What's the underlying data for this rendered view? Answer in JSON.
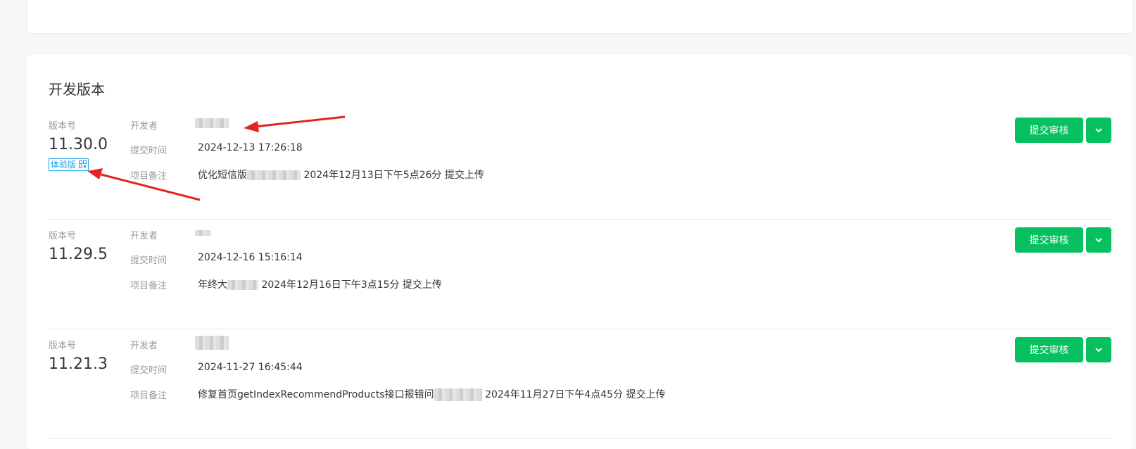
{
  "section_title": "开发版本",
  "accent_color": "#07c160",
  "tag_color": "#1aa0e6",
  "labels": {
    "version": "版本号",
    "developer": "开发者",
    "submit_time": "提交时间",
    "remark": "项目备注"
  },
  "versions": [
    {
      "version": "11.30.0",
      "tag": "体验版",
      "submit_time": "2024-12-13 17:26:18",
      "remark_prefix": "优化短信版",
      "remark_suffix": "2024年12月13日下午5点26分 提交上传",
      "submit_label": "提交审核"
    },
    {
      "version": "11.29.5",
      "submit_time": "2024-12-16 15:16:14",
      "remark_prefix": "年终大",
      "remark_suffix": "2024年12月16日下午3点15分 提交上传",
      "submit_label": "提交审核"
    },
    {
      "version": "11.21.3",
      "submit_time": "2024-11-27 16:45:44",
      "remark_prefix": "修复首页getIndexRecommendProducts接口报错问",
      "remark_suffix": "2024年11月27日下午4点45分 提交上传",
      "submit_label": "提交审核"
    }
  ],
  "icons": {
    "dropdown": "chevron-down-icon",
    "tag_qr": "qrcode-icon"
  }
}
